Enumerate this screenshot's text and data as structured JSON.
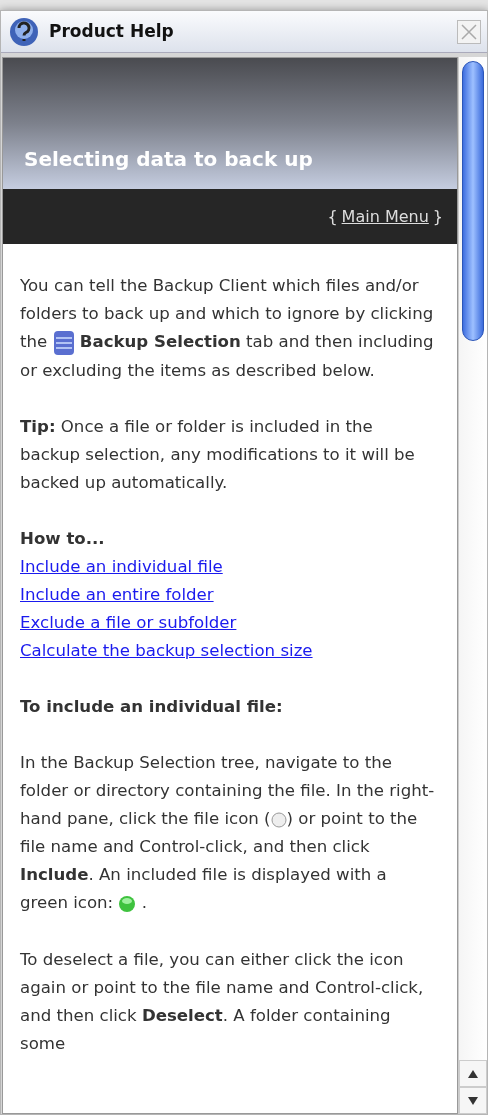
{
  "window": {
    "title": "Product Help"
  },
  "header": {
    "title": "Selecting data to back up",
    "nav_open": "{",
    "nav_link": "Main Menu",
    "nav_close": "}"
  },
  "blocks": [
    {
      "kind": "para",
      "parts": [
        {
          "kind": "text",
          "text": "You can tell the Backup Client which files and/or folders to back up and which to ignore by clicking the"
        },
        {
          "kind": "stack"
        },
        {
          "kind": "text",
          "text": "**Backup Selection** tab and then including or excluding the items as described below."
        }
      ]
    },
    {
      "kind": "para",
      "parts": [
        {
          "kind": "text",
          "text": "**Tip:** Once a file or folder is included in the backup selection, any modifications to it will be backed up automatically."
        }
      ]
    },
    {
      "kind": "links",
      "heading": "How to...",
      "links": [
        "Include an individual file",
        "Include an entire folder",
        "Exclude a file or subfolder",
        "Calculate the backup selection size"
      ]
    },
    {
      "kind": "heading",
      "text": "To include an individual file:"
    },
    {
      "kind": "para",
      "parts": [
        {
          "kind": "text",
          "text": "In the Backup Selection tree, navigate to the folder or directory containing the file. In the right-hand pane, click the file icon ("
        },
        {
          "kind": "ring"
        },
        {
          "kind": "text",
          "text": ") or point to the file name and Control-click, and then click **Include**. An included file is displayed with a green icon:"
        },
        {
          "kind": "dot"
        },
        {
          "kind": "text",
          "text": "."
        }
      ]
    },
    {
      "kind": "para",
      "parts": [
        {
          "kind": "text",
          "text": "To deselect a file, you can either click the icon again or point to the file name and Control-click, and then click **Deselect**. A folder containing some"
        }
      ]
    }
  ]
}
